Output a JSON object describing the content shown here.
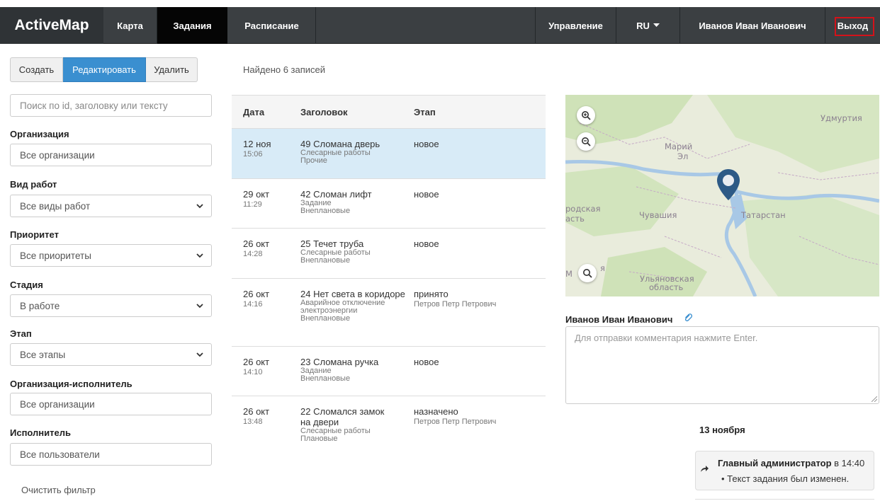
{
  "nav": {
    "brand": "ActiveMap",
    "map": "Карта",
    "tasks": "Задания",
    "schedule": "Расписание",
    "management": "Управление",
    "lang": "RU",
    "user": "Иванов Иван Иванович",
    "exit": "Выход"
  },
  "actions": {
    "create": "Создать",
    "edit": "Редактировать",
    "delete": "Удалить"
  },
  "filters": {
    "search_placeholder": "Поиск по id, заголовку или тексту",
    "org_label": "Организация",
    "org_value": "Все организации",
    "worktype_label": "Вид работ",
    "worktype_value": "Все виды работ",
    "priority_label": "Приоритет",
    "priority_value": "Все приоритеты",
    "stage_label": "Стадия",
    "stage_value": "В работе",
    "phase_label": "Этап",
    "phase_value": "Все этапы",
    "exec_org_label": "Организация-исполнитель",
    "exec_org_value": "Все организации",
    "executor_label": "Исполнитель",
    "executor_value": "Все пользователи",
    "clear": "Очистить фильтр"
  },
  "found": "Найдено 6 записей",
  "table": {
    "headers": {
      "date": "Дата",
      "title": "Заголовок",
      "stage": "Этап"
    },
    "rows": [
      {
        "date": "12 ноя",
        "time": "15:06",
        "title": "49 Сломана дверь",
        "sub1": "Слесарные работы",
        "sub2": "Прочие",
        "sub3": "",
        "stage": "новое",
        "person": ""
      },
      {
        "date": "29 окт",
        "time": "11:29",
        "title": "42 Сломан лифт",
        "sub1": "Задание",
        "sub2": "Внеплановые",
        "sub3": "",
        "stage": "новое",
        "person": ""
      },
      {
        "date": "26 окт",
        "time": "14:28",
        "title": "25 Течет труба",
        "sub1": "Слесарные работы",
        "sub2": "Внеплановые",
        "sub3": "",
        "stage": "новое",
        "person": ""
      },
      {
        "date": "26 окт",
        "time": "14:16",
        "title": "24 Нет света в коридоре",
        "sub1": "Аварийное отключение",
        "sub2": "электроэнергии",
        "sub3": "Внеплановые",
        "stage": "принято",
        "person": "Петров Петр Петрович"
      },
      {
        "date": "26 окт",
        "time": "14:10",
        "title": "23 Сломана ручка",
        "sub1": "Задание",
        "sub2": "Внеплановые",
        "sub3": "",
        "stage": "новое",
        "person": ""
      },
      {
        "date": "26 окт",
        "time": "13:48",
        "title": "22 Сломался замок на двери",
        "sub1": "Слесарные работы",
        "sub2": "Плановые",
        "sub3": "",
        "stage": "назначено",
        "person": "Петров Петр Петрович"
      }
    ]
  },
  "map": {
    "labels": [
      "Удмуртия",
      "Марий",
      "Эл",
      "Чувашия",
      "Татарстан",
      "Ульяновская",
      "область",
      "родская",
      "асть",
      "М",
      "я"
    ]
  },
  "comment": {
    "user": "Иванов Иван Иванович",
    "placeholder": "Для отправки комментария нажмите Enter."
  },
  "history": {
    "date": "13 ноября",
    "author": "Главный администратор",
    "time_text": " в 14:40",
    "item": "Текст задания был изменен."
  },
  "colors": {
    "accent": "#3a8fd0",
    "navbar": "#3b3f42",
    "selected_row": "#d8ebf7",
    "exit_outline": "#d4121a"
  }
}
